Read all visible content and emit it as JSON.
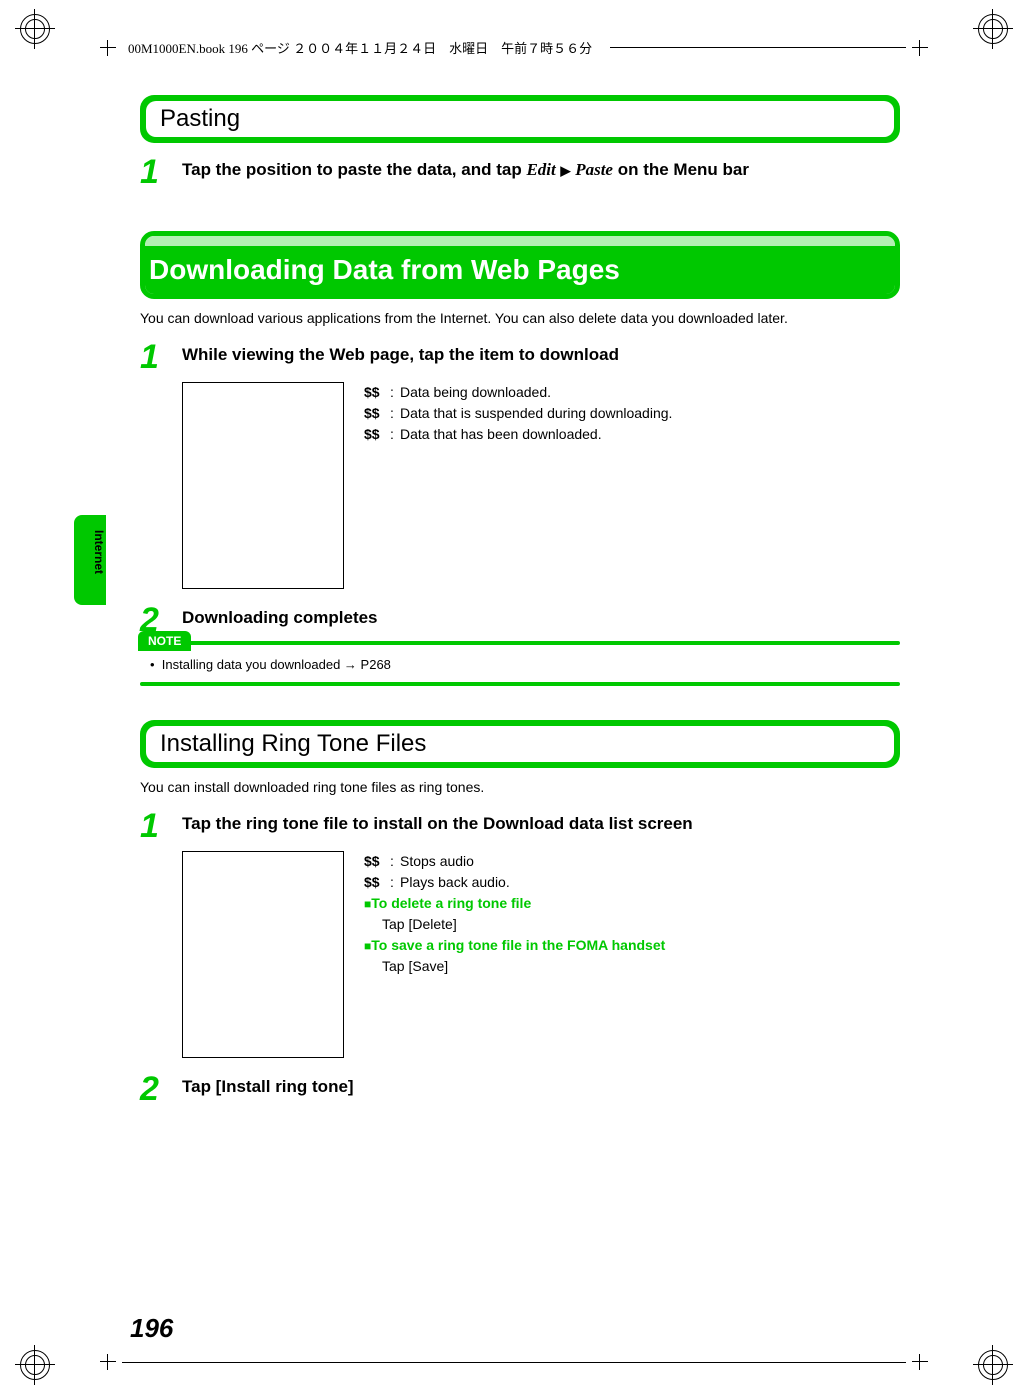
{
  "header": {
    "text": "00M1000EN.book  196 ページ  ２００４年１１月２４日　水曜日　午前７時５６分"
  },
  "sections": {
    "pasting": {
      "title": "Pasting",
      "step1_a": "Tap the position to paste the data, and tap ",
      "step1_edit": "Edit",
      "step1_paste": "Paste",
      "step1_b": " on the Menu bar"
    },
    "download": {
      "title": "Downloading Data from Web Pages",
      "intro": "You can download various applications from the Internet. You can also delete data you downloaded later.",
      "step1": "While viewing the Web page, tap the item to download",
      "legend": {
        "l1_sym": "$$",
        "l1_txt": "Data being downloaded.",
        "l2_sym": "$$",
        "l2_txt": "Data that is suspended during downloading.",
        "l3_sym": "$$",
        "l3_txt": "Data that has been downloaded."
      },
      "step2": "Downloading completes",
      "note_label": "NOTE",
      "note_bullet": "Installing data you downloaded → P268"
    },
    "ringtone": {
      "title": "Installing Ring Tone Files",
      "intro": "You can install downloaded ring tone files as ring tones.",
      "step1": "Tap the ring tone file to install on the Download data list screen",
      "legend": {
        "l1_sym": "$$",
        "l1_txt": "Stops audio",
        "l2_sym": "$$",
        "l2_txt": "Plays back audio.",
        "h1": "To delete a ring tone file",
        "h1_act": "Tap [Delete]",
        "h2": "To save a ring tone file in the FOMA handset",
        "h2_act": "Tap [Save]"
      },
      "step2": "Tap [Install ring tone]"
    }
  },
  "sidebar": {
    "label": "Internet"
  },
  "page_number": "196",
  "glyphs": {
    "triangle": "▶",
    "bullet": "•",
    "square": "■",
    "arrow": "→"
  }
}
